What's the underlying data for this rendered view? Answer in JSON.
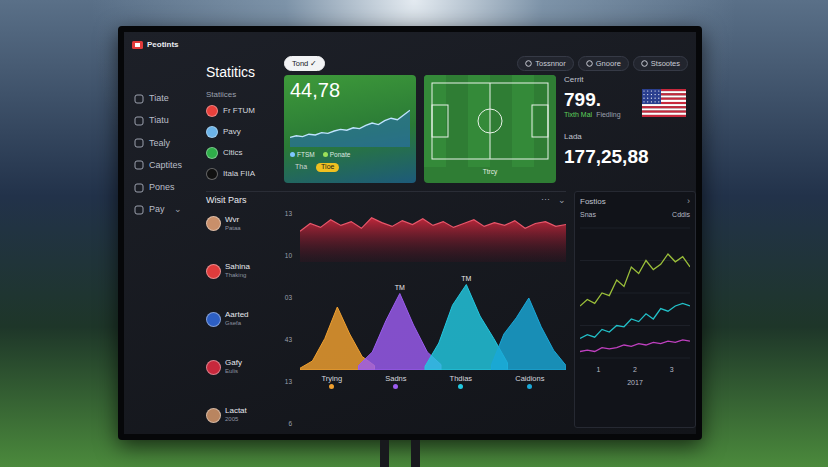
{
  "app": {
    "logo": "Peotints"
  },
  "sidebar": {
    "items": [
      {
        "label": "Tiate",
        "selected": false
      },
      {
        "label": "Tiatu",
        "selected": false
      },
      {
        "label": "Tealy",
        "selected": false
      },
      {
        "label": "Captites",
        "selected": false
      },
      {
        "label": "Pones",
        "selected": false
      },
      {
        "label": "Pay",
        "selected": false
      }
    ],
    "menu_arrow": "⌄"
  },
  "header": {
    "title": "Statitics",
    "subtitle": "Statiices"
  },
  "teams": [
    {
      "name": "Fr FTUM",
      "color": "#e8413c"
    },
    {
      "name": "Pavy",
      "color": "#6cb4e8"
    },
    {
      "name": "Cltics",
      "color": "#2fae4a"
    },
    {
      "name": "Itala FIIA",
      "color": "#111111"
    }
  ],
  "filters": [
    {
      "label": "Tond ✓",
      "selected": true
    },
    {
      "label": "Tossnnor",
      "selected": false
    },
    {
      "label": "Gnoore",
      "selected": false
    },
    {
      "label": "Stsootes",
      "selected": false
    }
  ],
  "trend": {
    "value": "44,78",
    "legend": [
      "FTSM",
      "Ponate"
    ],
    "values": [
      12,
      14,
      13,
      16,
      15,
      18,
      17,
      20,
      22,
      21,
      24,
      23,
      27,
      30,
      28,
      33,
      36,
      34,
      40,
      46
    ],
    "toggle": [
      {
        "label": "Tha",
        "selected": false
      },
      {
        "label": "Tioe",
        "selected": true
      }
    ]
  },
  "pitch": {
    "label": "Ttrcy"
  },
  "stats": {
    "current_label": "Cerrit",
    "current_value": "799.",
    "current_note": "Tixth Mal",
    "current_note2": "Fiedling",
    "total_label": "Lada",
    "total_value": "177,25,88"
  },
  "players": {
    "title": "Wisit Pars",
    "menu": "⋯",
    "arrow": "⌄",
    "items": [
      {
        "name": "Wvr",
        "sub": "Pataa",
        "color": "#c98f6a"
      },
      {
        "name": "Sahina",
        "sub": "Thaking",
        "color": "#e03c3c"
      },
      {
        "name": "Aarted",
        "sub": "Gsefa",
        "color": "#2d5fc4"
      },
      {
        "name": "Gafy",
        "sub": "Eulis",
        "color": "#c8283c"
      },
      {
        "name": "Lactat",
        "sub": "2005",
        "color": "#b98560"
      }
    ],
    "y_ticks": [
      "13",
      "10",
      "03",
      "43",
      "13",
      "6"
    ]
  },
  "wave": {
    "values": [
      30,
      38,
      34,
      42,
      36,
      40,
      33,
      44,
      39,
      35,
      41,
      37,
      43,
      36,
      40,
      34,
      38,
      42,
      35,
      39,
      36,
      41,
      33,
      38,
      40,
      35,
      37
    ]
  },
  "peaks": {
    "series": [
      {
        "label": "Trying",
        "color": "#f0a030",
        "values": [
          2,
          10,
          35,
          70,
          40,
          15,
          5
        ]
      },
      {
        "label": "Sadns",
        "color": "#9b5cf0",
        "values": [
          5,
          20,
          55,
          85,
          50,
          20,
          6
        ],
        "tag": "TM"
      },
      {
        "label": "Thdias",
        "color": "#22c8e0",
        "values": [
          4,
          30,
          72,
          95,
          60,
          35,
          8
        ],
        "tag": "TM"
      },
      {
        "label": "Caidions",
        "color": "#1aa8d8",
        "values": [
          6,
          40,
          58,
          80,
          48,
          22,
          5
        ]
      }
    ]
  },
  "form": {
    "title": "Fostios",
    "arrow": "›",
    "legend": [
      "Snas",
      "Cddis"
    ],
    "x_ticks": [
      "1",
      "2",
      "3"
    ],
    "year": "2017",
    "series": [
      {
        "color": "#9bbf3a",
        "values": [
          40,
          45,
          42,
          50,
          48,
          60,
          55,
          70,
          65,
          75,
          68,
          72,
          80,
          74,
          78,
          70
        ]
      },
      {
        "color": "#22c0c8",
        "values": [
          15,
          18,
          16,
          22,
          20,
          25,
          24,
          30,
          28,
          34,
          30,
          38,
          36,
          40,
          42,
          40
        ]
      },
      {
        "color": "#c040c0",
        "values": [
          5,
          6,
          5,
          8,
          7,
          8,
          10,
          9,
          11,
          10,
          12,
          11,
          13,
          12,
          14,
          13
        ]
      }
    ]
  }
}
